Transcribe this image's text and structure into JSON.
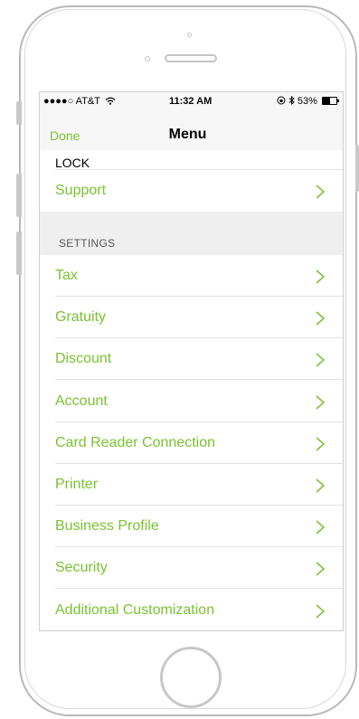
{
  "status_bar": {
    "carrier": "●●●●○ AT&T",
    "time": "11:32 AM",
    "battery_text": "53%",
    "battery_level": 0.53
  },
  "nav": {
    "done_label": "Done",
    "title": "Menu"
  },
  "menu": {
    "clipped_item": "Lock",
    "support_label": "Support",
    "settings_header": "SETTINGS",
    "settings_items": [
      "Tax",
      "Gratuity",
      "Discount",
      "Account",
      "Card Reader Connection",
      "Printer",
      "Business Profile",
      "Security",
      "Additional Customization"
    ]
  },
  "colors": {
    "accent": "#7ac231",
    "header_bg": "#efefef",
    "bar_bg": "#f7f7f7"
  },
  "icons": {
    "row_disclosure": "chevron-right-icon",
    "wifi": "wifi-icon",
    "orientation_lock": "orientation-lock-icon",
    "bluetooth": "bluetooth-icon",
    "battery": "battery-icon"
  }
}
